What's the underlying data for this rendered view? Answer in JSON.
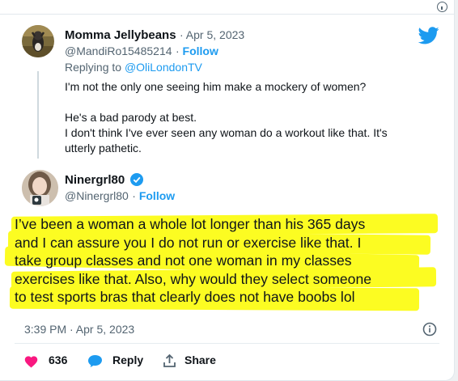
{
  "reply_tweet": {
    "display_name": "Momma Jellybeans",
    "date": "Apr 5, 2023",
    "handle": "@MandiRo15485214",
    "follow_label": "Follow",
    "replying_to_prefix": "Replying to",
    "replying_to_handle": "@OliLondonTV",
    "lines": [
      "I'm not the only one seeing him make a mockery of women?",
      "He's a bad parody at best.",
      "I don't think I've ever seen any woman do a workout like that. It's",
      "utterly pathetic."
    ]
  },
  "main_tweet": {
    "display_name": "Ninergrl80",
    "handle": "@Ninergrl80",
    "follow_label": "Follow",
    "lines": [
      "I’ve been a woman a whole lot longer than his 365 days",
      "and I can assure you I do not run or exercise like that. I",
      "take group classes and not one woman in my classes",
      "exercises like that. Also, why would they select someone",
      "to test sports bras that clearly does not have boobs lol"
    ],
    "timestamp": "3:39 PM · Apr 5, 2023",
    "like_count": "636",
    "reply_label": "Reply",
    "share_label": "Share"
  },
  "icons": {
    "brand": "twitter-bird-icon",
    "verified": "verified-badge-icon",
    "info": "info-icon",
    "like": "heart-icon",
    "reply": "reply-bubble-icon",
    "share": "share-icon"
  },
  "colors": {
    "accent": "#1d9bf0",
    "highlight": "#fcfc22",
    "like": "#f91880",
    "text": "#0f1419",
    "muted": "#536471"
  }
}
